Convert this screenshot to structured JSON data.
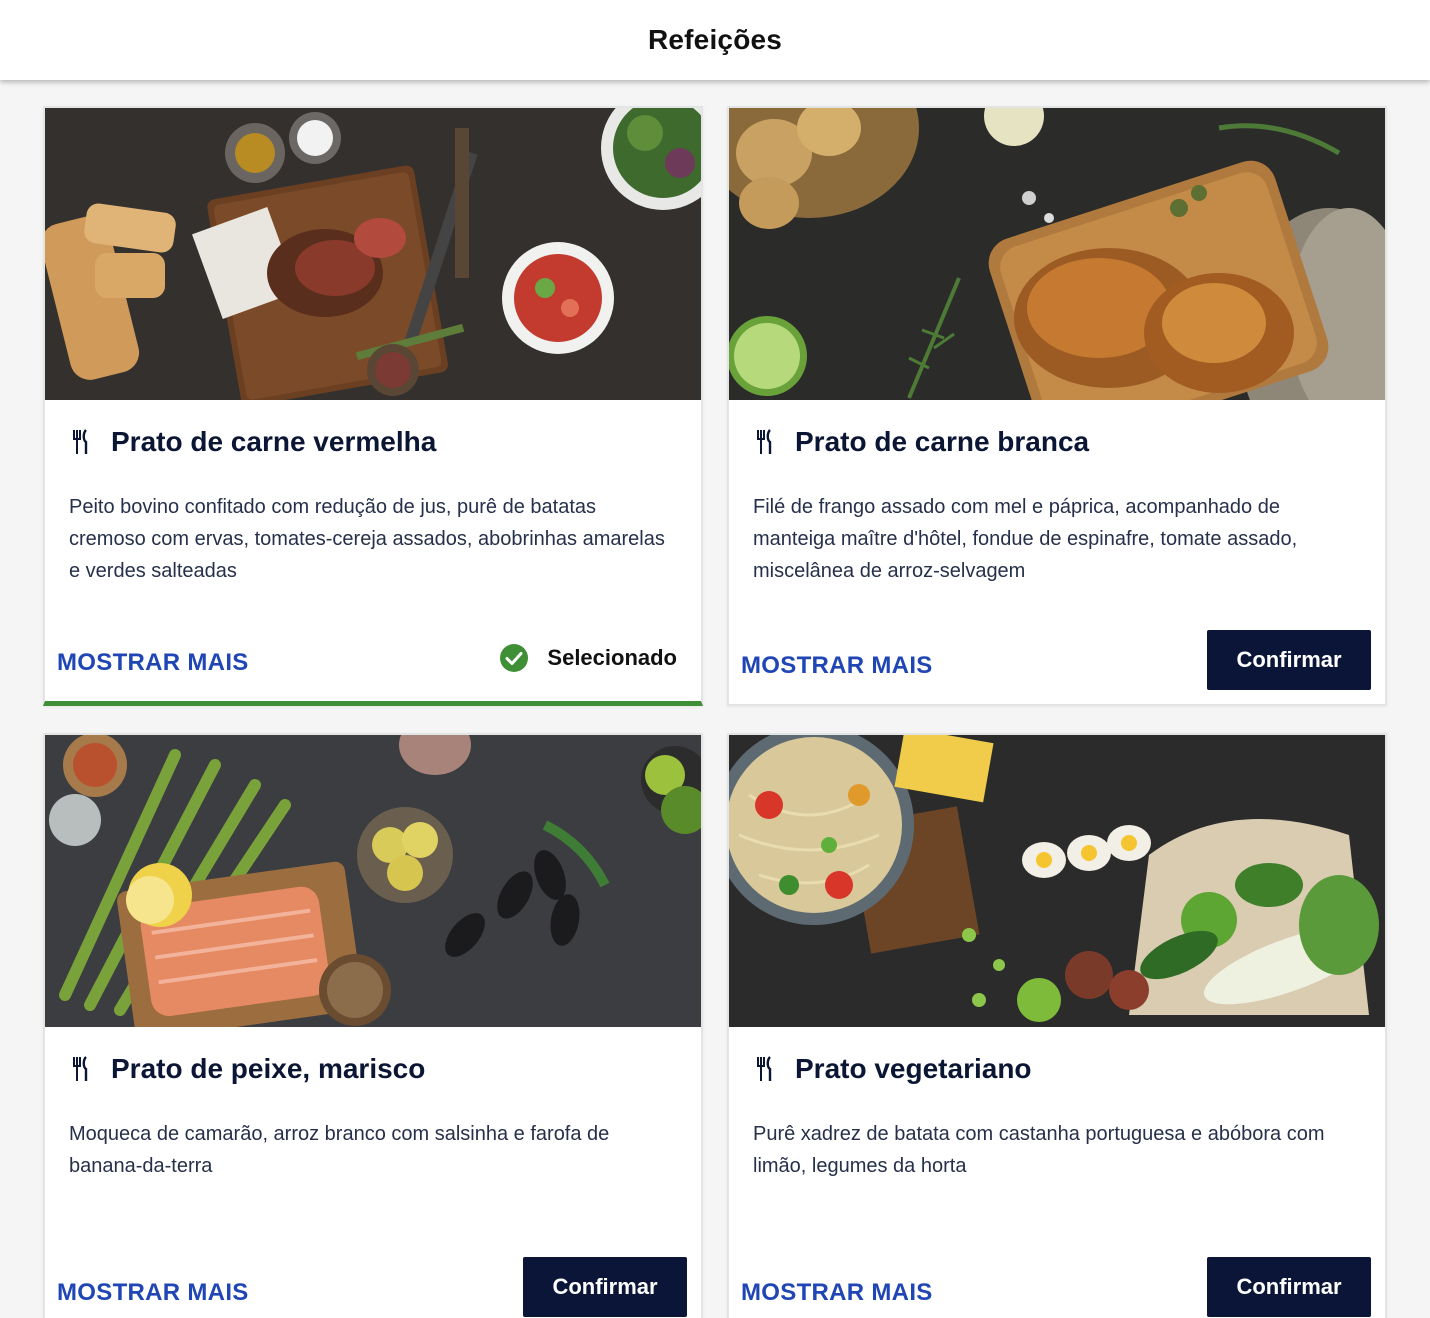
{
  "header": {
    "title": "Refeições"
  },
  "meals": [
    {
      "title": "Prato de carne vermelha",
      "description": "Peito bovino confitado com redução de jus, purê de batatas cremoso com ervas, tomates-cereja assados, abobrinhas amarelas e verdes salteadas",
      "more_label": "MOSTRAR MAIS",
      "status_label": "Selecionado",
      "selected": true,
      "icon": "fork-knife-icon"
    },
    {
      "title": "Prato de carne branca",
      "description": "Filé de frango assado com mel e páprica, acompanhado de manteiga maître d'hôtel, fondue de espinafre, tomate assado, miscelânea de arroz-selvagem",
      "more_label": "MOSTRAR MAIS",
      "button_label": "Confirmar",
      "selected": false,
      "icon": "fork-knife-icon"
    },
    {
      "title": "Prato de peixe, marisco",
      "description": "Moqueca de camarão, arroz branco com salsinha e farofa de banana-da-terra",
      "more_label": "MOSTRAR MAIS",
      "button_label": "Confirmar",
      "selected": false,
      "icon": "fork-knife-icon"
    },
    {
      "title": "Prato vegetariano",
      "description": "Purê xadrez de batata com castanha portuguesa e abóbora com limão, legumes da horta",
      "more_label": "MOSTRAR MAIS",
      "button_label": "Confirmar",
      "selected": false,
      "icon": "fork-knife-icon"
    }
  ],
  "colors": {
    "primary_navy": "#0b1538",
    "link_blue": "#1f46b4",
    "selected_green": "#3f8f36"
  }
}
